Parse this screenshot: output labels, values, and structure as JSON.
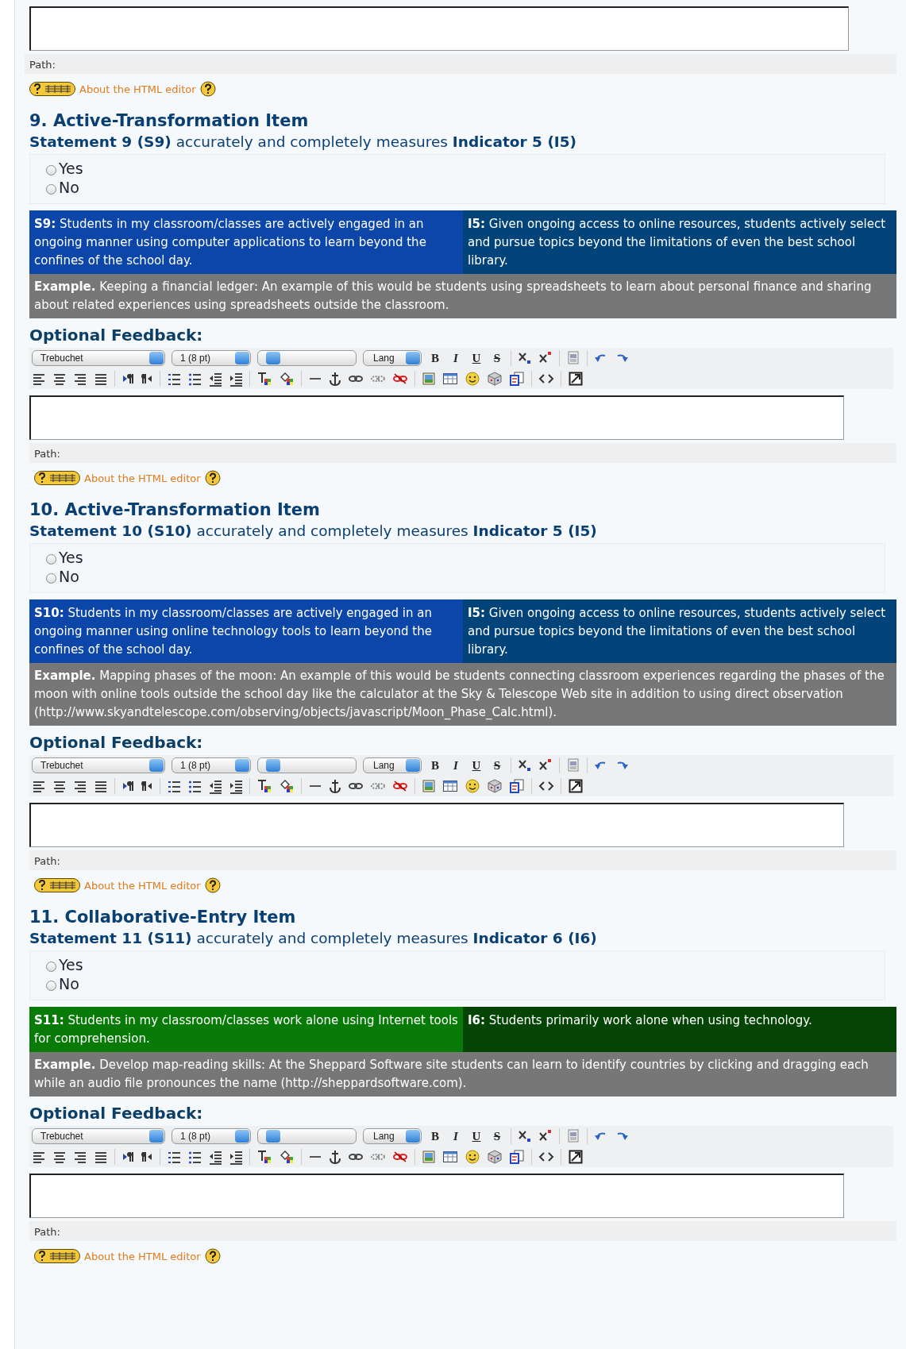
{
  "top_editor": {
    "path_label": "Path:",
    "about_link": "About the HTML editor"
  },
  "items": [
    {
      "heading": "9. Active-Transformation Item",
      "statement": "**Statement 9 (S9)** accurately and completely measures **Indicator 5 (I5)**",
      "options": [
        {
          "label": "Yes",
          "selected": false
        },
        {
          "label": "No",
          "selected": false
        }
      ],
      "statement_cell": {
        "text": "**S9:** Students in my classroom/classes are actively engaged in an ongoing manner using computer applications to learn beyond the confines of the school day.",
        "color": "#0b46a8"
      },
      "indicator_cell": {
        "text": "**I5:** Given ongoing access to online resources, students actively select and pursue topics beyond the limitations of even the best school library.",
        "color": "#024379"
      },
      "example": "**Example.** Keeping a financial ledger: An example of this would be students using spreadsheets to learn about personal finance and sharing about related experiences using spreadsheets outside the classroom.",
      "feedback_label": "Optional Feedback:",
      "editor": {
        "font": "Trebuchet",
        "size": "1 (8 pt)",
        "lang": "Lang",
        "format_buttons": [
          "B",
          "I",
          "U",
          "S"
        ],
        "path_label": "Path:",
        "about_link": "About the HTML editor"
      }
    },
    {
      "heading": "10. Active-Transformation Item",
      "statement": "**Statement 10 (S10)** accurately and completely measures **Indicator 5 (I5)**",
      "options": [
        {
          "label": "Yes",
          "selected": false
        },
        {
          "label": "No",
          "selected": false
        }
      ],
      "statement_cell": {
        "text": "**S10:** Students in my classroom/classes are actively engaged in an ongoing manner using online technology tools to learn beyond the confines of the school day.",
        "color": "#0b46a8"
      },
      "indicator_cell": {
        "text": "**I5:** Given ongoing access to online resources, students actively select and pursue topics beyond the limitations of even the best school library.",
        "color": "#024379"
      },
      "example": "**Example.** Mapping phases of the moon: An example of this would be students connecting classroom experiences regarding the phases of the moon with online tools outside the school day like the calculator at the Sky & Telescope Web site in addition to using direct observation (http://www.skyandtelescope.com/observing/objects/javascript/Moon_Phase_Calc.html).",
      "feedback_label": "Optional Feedback:",
      "editor": {
        "font": "Trebuchet",
        "size": "1 (8 pt)",
        "lang": "Lang",
        "format_buttons": [
          "B",
          "I",
          "U",
          "S"
        ],
        "path_label": "Path:",
        "about_link": "About the HTML editor"
      }
    },
    {
      "heading": "11. Collaborative-Entry Item",
      "statement": "**Statement 11 (S11)** accurately and completely measures **Indicator 6 (I6)**",
      "options": [
        {
          "label": "Yes",
          "selected": false
        },
        {
          "label": "No",
          "selected": false
        }
      ],
      "statement_cell": {
        "text": "**S11:** Students in my classroom/classes work alone using Internet tools for comprehension.",
        "color": "#087a08"
      },
      "indicator_cell": {
        "text": "**I6:** Students primarily work alone when using technology.",
        "color": "#044404"
      },
      "example": "**Example.** Develop map-reading skills: At the Sheppard Software site students can learn to identify countries by clicking and dragging each while an audio file pronounces the name (http://sheppardsoftware.com).",
      "feedback_label": "Optional Feedback:",
      "editor": {
        "font": "Trebuchet",
        "size": "1 (8 pt)",
        "lang": "Lang",
        "format_buttons": [
          "B",
          "I",
          "U",
          "S"
        ],
        "path_label": "Path:",
        "about_link": "About the HTML editor"
      }
    }
  ]
}
